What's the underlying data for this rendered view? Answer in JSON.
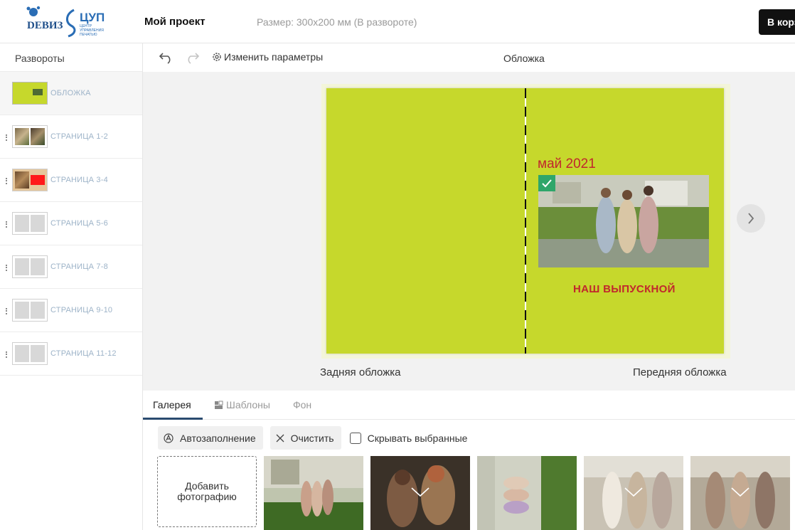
{
  "header": {
    "project_title": "Мой проект",
    "project_size": "Размер: 300x200 мм (В развороте)",
    "cart_label": "В корзину",
    "logo_left": "DEВИЗ",
    "logo_right": "ЦУП",
    "logo_right_sub": "ЦЕНТР УПРАВЛЕНИЯ ПЕЧАТЬЮ"
  },
  "sidebar": {
    "title": "Развороты",
    "items": [
      {
        "label": "ОБЛОЖКА"
      },
      {
        "label": "СТРАНИЦА 1-2"
      },
      {
        "label": "СТРАНИЦА 3-4"
      },
      {
        "label": "СТРАНИЦА 5-6"
      },
      {
        "label": "СТРАНИЦА 7-8"
      },
      {
        "label": "СТРАНИЦА 9-10"
      },
      {
        "label": "СТРАНИЦА 11-12"
      }
    ]
  },
  "toolbar": {
    "params_label": "Изменить параметры",
    "section_title": "Обложка"
  },
  "canvas": {
    "date_text": "май 2021",
    "caption": "НАШ ВЫПУСКНОЙ",
    "back_label": "Задняя обложка",
    "front_label": "Передняя обложка",
    "cover_color": "#c6d82c",
    "text_color": "#c1272d"
  },
  "bottom": {
    "tabs": [
      {
        "label": "Галерея"
      },
      {
        "label": "Шаблоны"
      },
      {
        "label": "Фон"
      }
    ],
    "autofill_label": "Автозаполнение",
    "clear_label": "Очистить",
    "hide_selected_label": "Скрывать выбранные",
    "add_photo_line1": "Добавить",
    "add_photo_line2": "фотографию"
  }
}
